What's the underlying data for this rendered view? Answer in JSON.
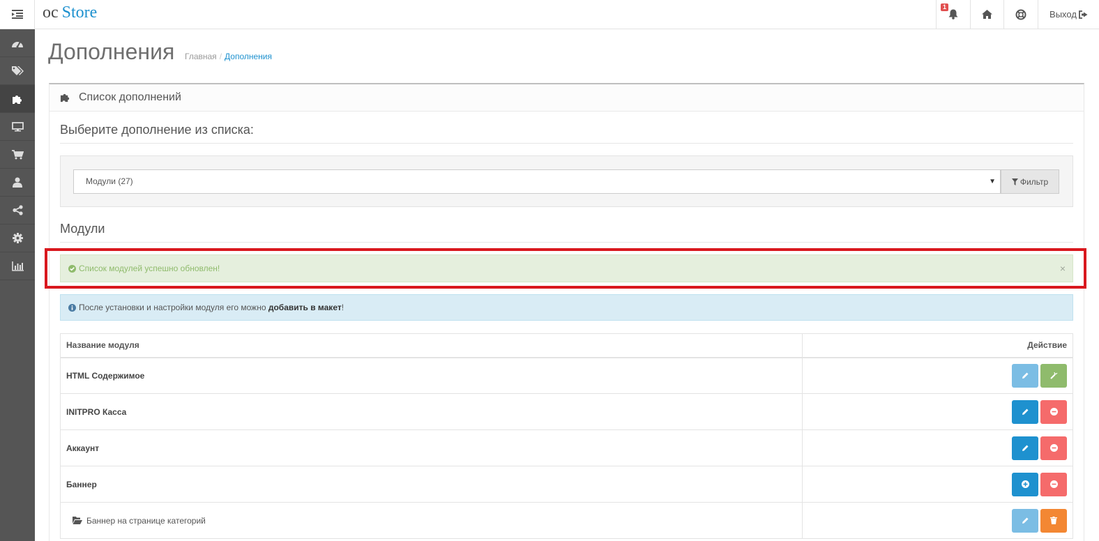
{
  "header": {
    "logo_part1": "oc",
    "logo_part2": "Store",
    "notification_count": "1",
    "logout_label": "Выход"
  },
  "sidebar": {
    "items": [
      {
        "icon": "dashboard-icon"
      },
      {
        "icon": "tags-icon"
      },
      {
        "icon": "puzzle-icon",
        "active": true
      },
      {
        "icon": "desktop-icon"
      },
      {
        "icon": "cart-icon"
      },
      {
        "icon": "user-icon"
      },
      {
        "icon": "share-icon"
      },
      {
        "icon": "cog-icon"
      },
      {
        "icon": "bar-chart-icon"
      }
    ]
  },
  "page": {
    "title": "Дополнения",
    "breadcrumb": [
      "Главная",
      "Дополнения"
    ]
  },
  "panel": {
    "title": "Список дополнений",
    "choose_label": "Выберите дополнение из списка:",
    "select_value": "Модули (27)",
    "filter_label": "Фильтр",
    "section_title": "Модули",
    "success_message": "Список модулей успешно обновлен!",
    "info_text_before": "После установки и настройки модуля его можно ",
    "info_text_bold": "добавить в макет",
    "info_text_after": "!"
  },
  "table": {
    "col_name": "Название модуля",
    "col_action": "Действие",
    "rows": [
      {
        "name": "HTML Содержимое",
        "buttons": [
          "edit-disabled",
          "install"
        ]
      },
      {
        "name": "INITPRO Касса",
        "buttons": [
          "edit",
          "uninstall"
        ]
      },
      {
        "name": "Аккаунт",
        "buttons": [
          "edit",
          "uninstall"
        ]
      },
      {
        "name": "Баннер",
        "buttons": [
          "add",
          "uninstall"
        ]
      },
      {
        "name": "Баннер на странице категорий",
        "sub": true,
        "buttons": [
          "edit-disabled",
          "delete"
        ]
      }
    ]
  },
  "colors": {
    "primary": "#1e91cf",
    "success": "#8fbb6c",
    "danger": "#f56b6b",
    "warning": "#f38733",
    "highlight": "#d9181e"
  }
}
